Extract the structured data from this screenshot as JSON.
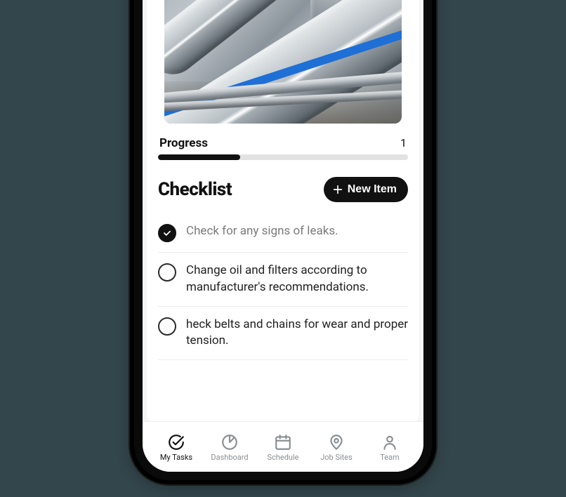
{
  "progress": {
    "label": "Progress",
    "value": "1",
    "percent": 33
  },
  "checklist": {
    "title": "Checklist",
    "new_item_label": "New Item",
    "items": [
      {
        "text": "Check for any signs of leaks.",
        "checked": true
      },
      {
        "text": "Change oil and filters according to manufacturer's recommendations.",
        "checked": false
      },
      {
        "text": "heck belts and chains for wear and proper tension.",
        "checked": false
      }
    ]
  },
  "tabs": {
    "my_tasks": "My Tasks",
    "dashboard": "Dashboard",
    "schedule": "Schedule",
    "job_sites": "Job Sites",
    "team": "Team"
  }
}
